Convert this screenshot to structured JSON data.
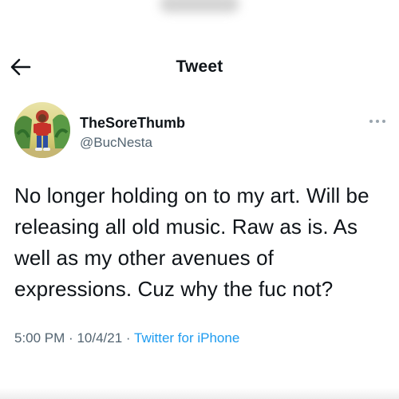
{
  "header": {
    "title": "Tweet",
    "back_icon": "arrow-left-icon"
  },
  "author": {
    "display_name": "TheSoreThumb",
    "handle": "@BucNesta",
    "more_icon": "more-horizontal-icon"
  },
  "tweet": {
    "text": "No longer holding on to my art. Will be releasing all old music. Raw as is. As well as my other avenues of expressions. Cuz why the fuc not?"
  },
  "meta": {
    "time": "5:00 PM",
    "separator": "·",
    "date": "10/4/21",
    "source": "Twitter for iPhone"
  },
  "colors": {
    "text": "#0f1419",
    "secondary": "#536471",
    "link": "#1d9bf0"
  }
}
